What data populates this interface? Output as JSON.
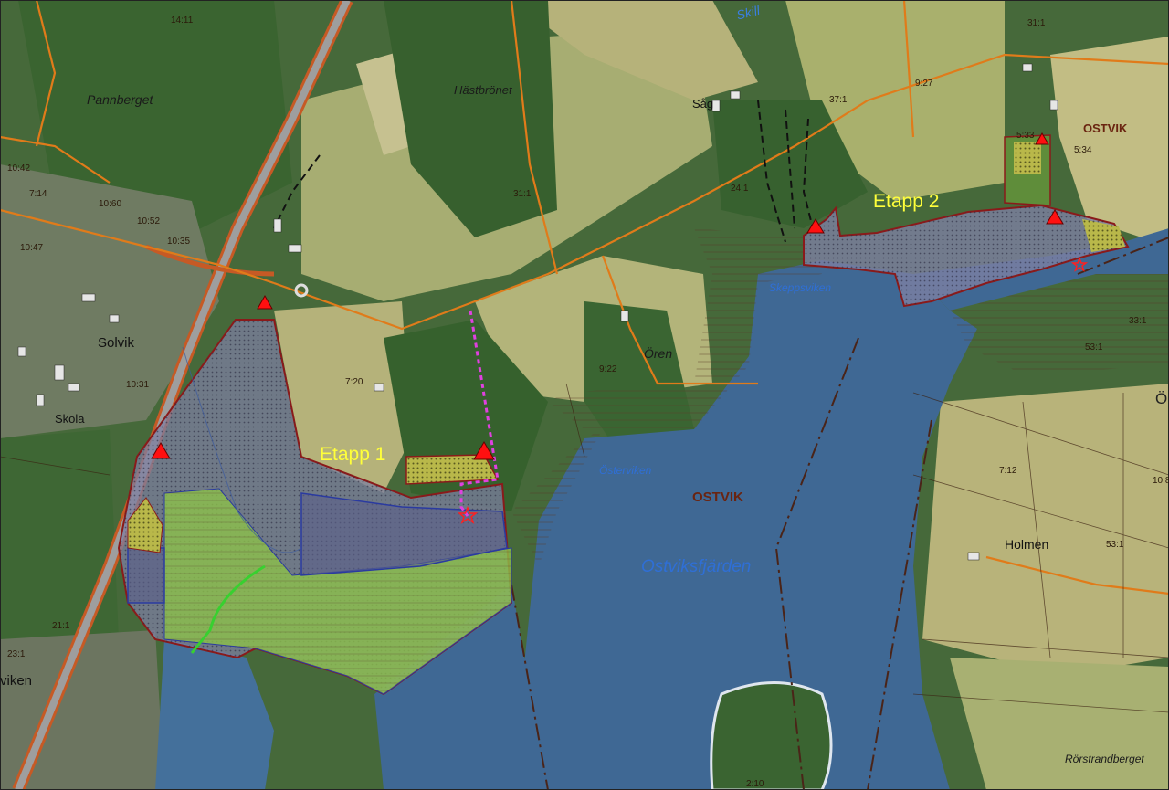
{
  "map": {
    "stages": [
      "Etapp 1",
      "Etapp 2"
    ],
    "places": {
      "solvik": "Solvik",
      "skola": "Skola",
      "oren": "Ören",
      "holmen": "Holmen",
      "sag": "Såg",
      "viken": "viken",
      "ostvik_ne": "OSTVIK",
      "edge_o": "Ö"
    },
    "hills": {
      "pannberget": "Pannberget",
      "hastbronet": "Hästbrönet",
      "rorstrandberget": "Rörstrandberget"
    },
    "water": {
      "skeppsviken": "Skeppsviken",
      "osterviken": "Österviken",
      "ostviksfjarden": "Ostviksfjärden",
      "stream": "Skill"
    },
    "area_label": "OSTVIK",
    "parcels": [
      "14:11",
      "31:1",
      "31:1",
      "9:27",
      "37:1",
      "5:33",
      "5:34",
      "24:1",
      "7:20",
      "9:22",
      "10:35",
      "10:31",
      "10:42",
      "7:14",
      "10:47",
      "10:60",
      "10:52",
      "33:1",
      "53:1",
      "53:1",
      "7:12",
      "21:1",
      "23:1",
      "2:10",
      "10:8"
    ],
    "colors": {
      "water": "#3f6894",
      "forest": "#3f6a35",
      "field": "#a8b070",
      "boundary": "#8a1a1a",
      "road": "#e07b1a",
      "stage_label": "#ffff3a",
      "triangle": "#ff1010",
      "path": "#e040e0"
    },
    "icons": [
      "triangle-marker-icon",
      "star-marker-icon"
    ]
  }
}
